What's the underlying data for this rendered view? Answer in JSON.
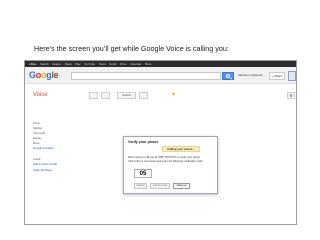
{
  "caption": "Here’s the screen you’ll get while Google Voice is calling you:",
  "topbar": [
    "+You",
    "Search",
    "Images",
    "Maps",
    "Play",
    "YouTube",
    "News",
    "Gmail",
    "Drive",
    "Calendar",
    "More"
  ],
  "header": {
    "logo": [
      "G",
      "o",
      "o",
      "g",
      "l",
      "e"
    ],
    "user": "harrison.m@gmail",
    "share_label": "+ Share"
  },
  "app": {
    "title": "Voice",
    "action_label": "Actions"
  },
  "sidebar": {
    "items": [
      "Inbox",
      "Starred",
      "Voicemail",
      "History",
      "More"
    ],
    "groups_label": "Google Contacts",
    "credit_label": "Credit",
    "add_credit_label": "Add to Voice Credit",
    "voice_number_label": "Voice Numbers"
  },
  "dialog": {
    "title": "Verify your phone",
    "status": "Calling your phone...",
    "message_1": "We're going to call you at (785) 748-XXXX to verify your phone.",
    "message_2": "Click Call me now below and enter the following verification code:",
    "code": "05",
    "cancel_label": "Cancel",
    "call_label": "Call me now",
    "hangup_label": "Hang up"
  },
  "colors": {
    "accent": "#dd4b39",
    "link": "#1155cc",
    "status_bg": "#f9edbe",
    "search_button": "#4d90fe"
  }
}
